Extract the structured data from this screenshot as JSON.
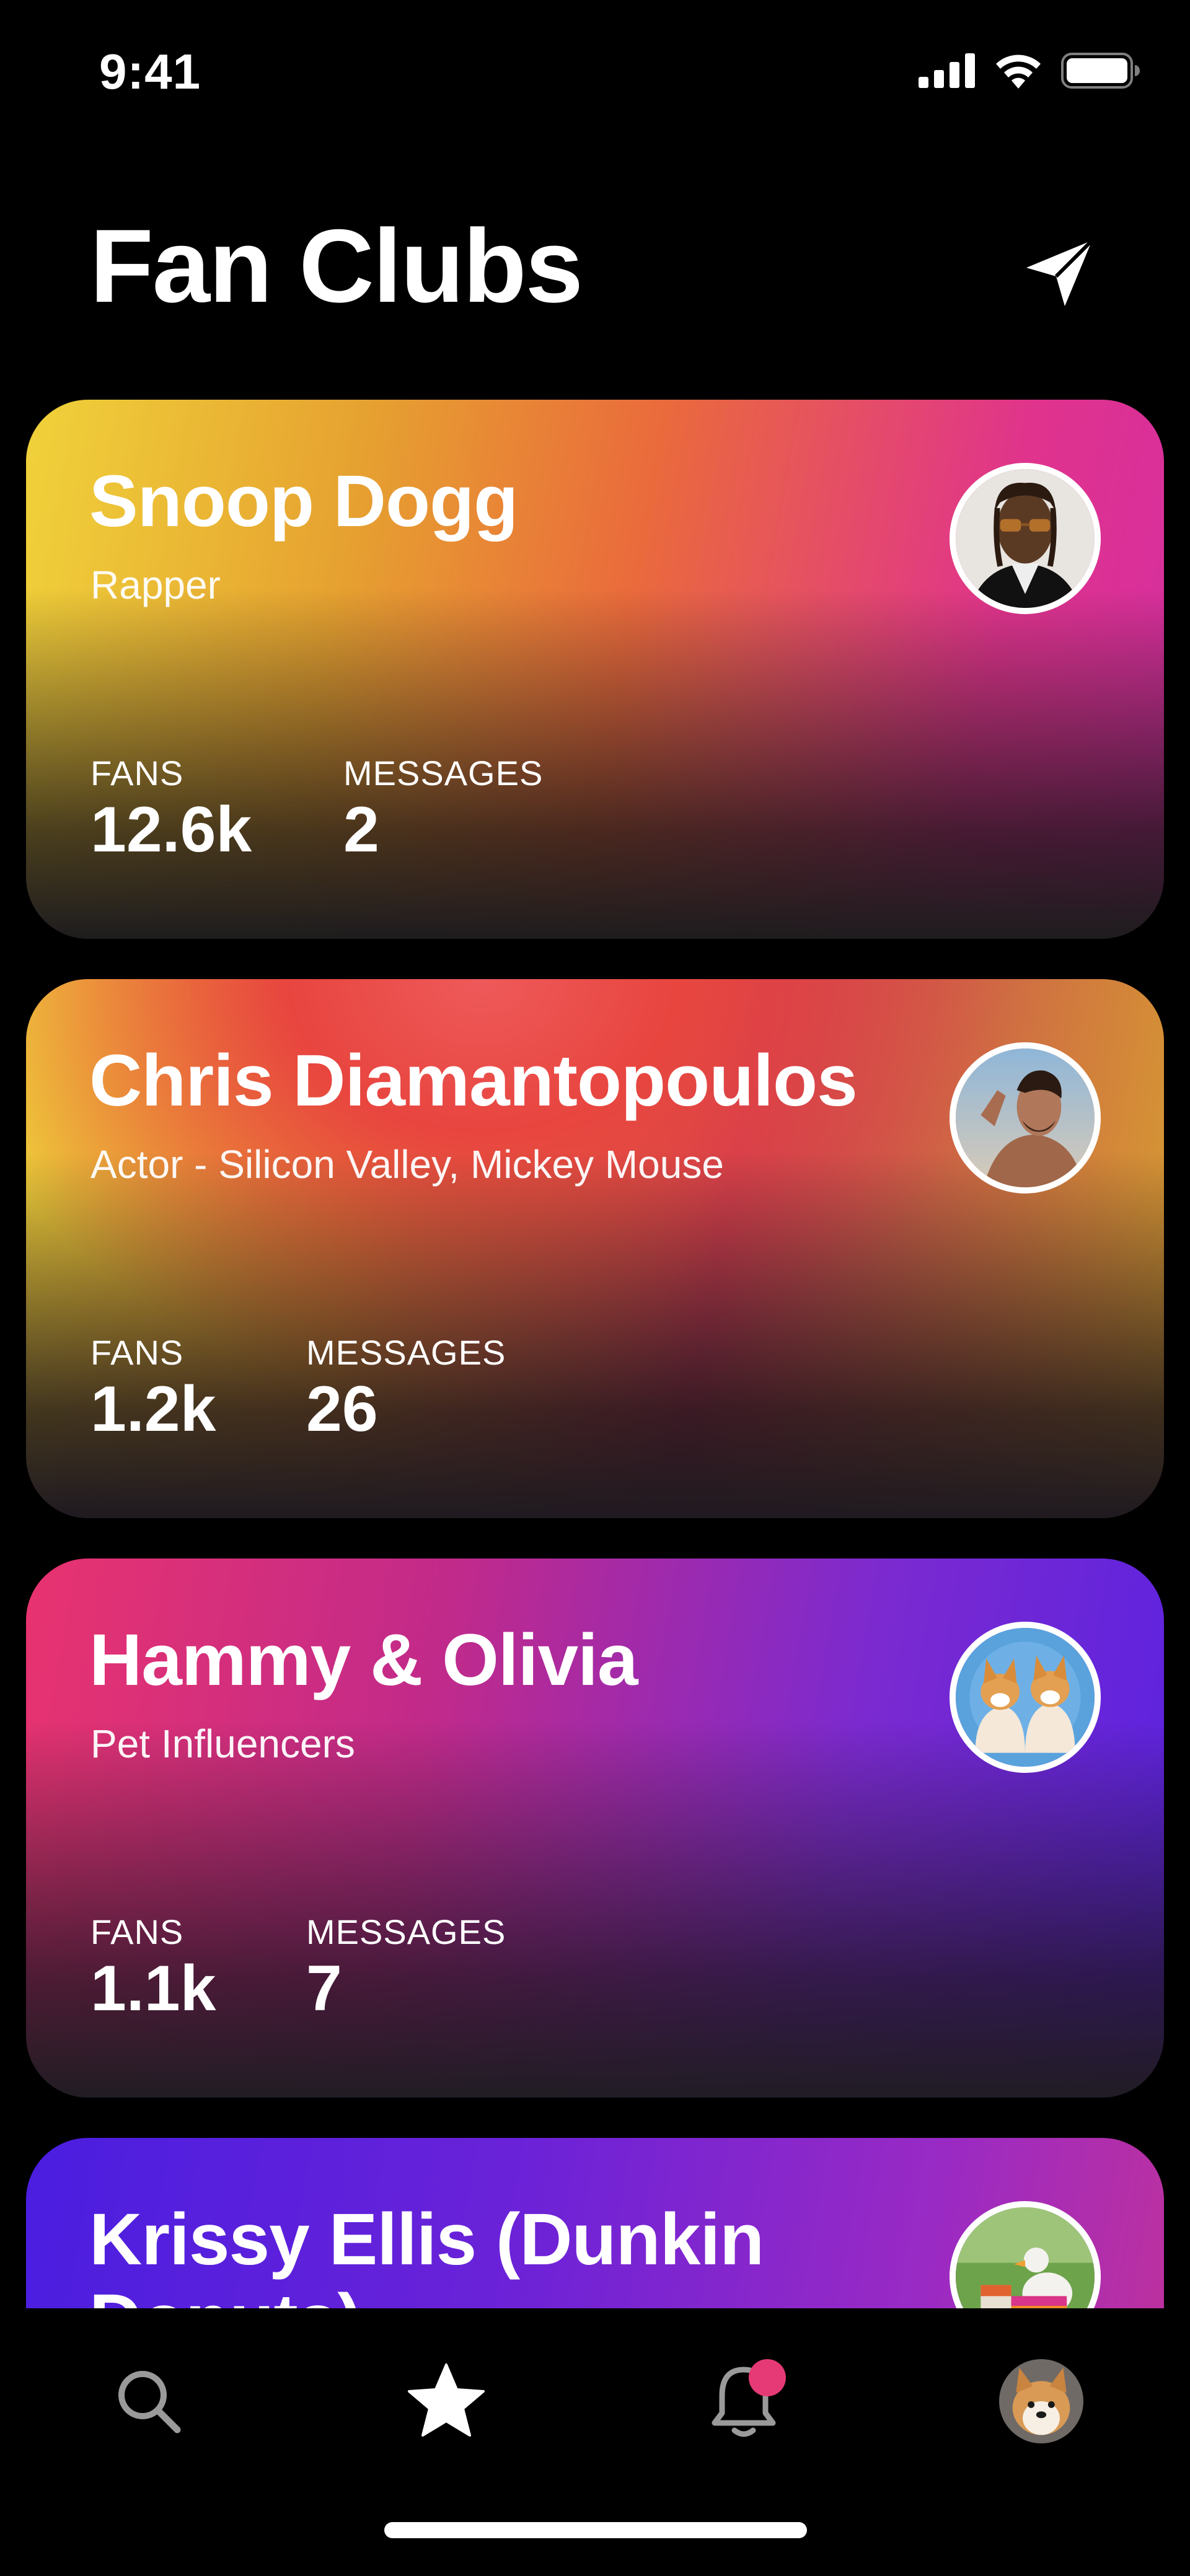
{
  "status_bar": {
    "time": "9:41"
  },
  "header": {
    "title": "Fan Clubs"
  },
  "clubs": [
    {
      "name": "Snoop Dogg",
      "subtitle": "Rapper",
      "fans_label": "FANS",
      "fans": "12.6k",
      "messages_label": "MESSAGES",
      "messages": "2"
    },
    {
      "name": "Chris Diamantopoulos",
      "subtitle": "Actor - Silicon Valley, Mickey Mouse",
      "fans_label": "FANS",
      "fans": "1.2k",
      "messages_label": "MESSAGES",
      "messages": "26"
    },
    {
      "name": "Hammy & Olivia",
      "subtitle": "Pet Influencers",
      "fans_label": "FANS",
      "fans": "1.1k",
      "messages_label": "MESSAGES",
      "messages": "7"
    },
    {
      "name": "Krissy Ellis (Dunkin Donuts)"
    }
  ],
  "tab_bar": {
    "tabs": [
      "search-icon",
      "star-icon",
      "bell-icon",
      "profile-avatar"
    ],
    "active_color": "#ffffff",
    "inactive_color": "#9a9a9a",
    "badge_color": "#e63a76"
  }
}
